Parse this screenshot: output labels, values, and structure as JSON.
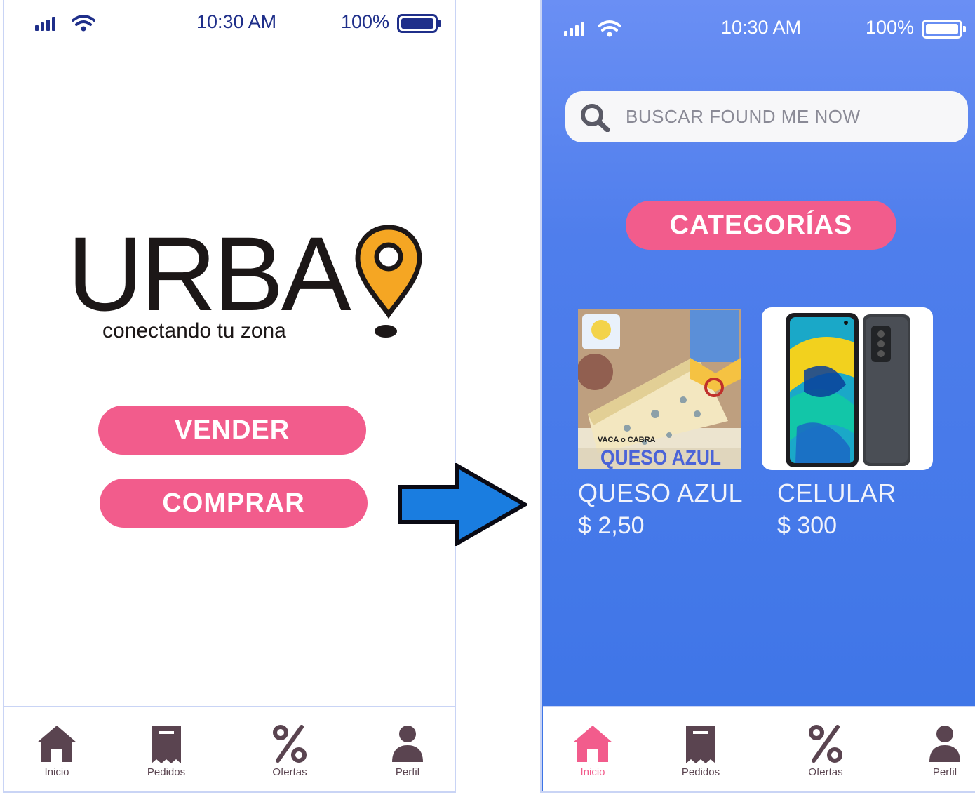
{
  "screens": {
    "landing": {
      "status_bar": {
        "time": "10:30 AM",
        "battery": "100%"
      },
      "logo": {
        "wordmark": "URBA",
        "tagline": "conectando tu zona"
      },
      "buttons": {
        "sell": "VENDER",
        "buy": "COMPRAR"
      },
      "tabs": [
        {
          "label": "Inicio",
          "icon": "home-icon"
        },
        {
          "label": "Pedidos",
          "icon": "receipt-icon"
        },
        {
          "label": "Ofertas",
          "icon": "percent-icon"
        },
        {
          "label": "Perfil",
          "icon": "user-icon"
        }
      ]
    },
    "catalog": {
      "status_bar": {
        "time": "10:30 AM",
        "battery": "100%"
      },
      "search": {
        "placeholder": "BUSCAR FOUND ME NOW"
      },
      "categories_label": "CATEGORÍAS",
      "products": [
        {
          "name": "QUESO AZUL",
          "price": "$ 2,50",
          "image_caption_small": "VACA o CABRA",
          "image_caption_large": "QUESO AZUL"
        },
        {
          "name": "CELULAR",
          "price": "$ 300"
        }
      ],
      "tabs": [
        {
          "label": "Inicio",
          "icon": "home-icon",
          "active": true
        },
        {
          "label": "Pedidos",
          "icon": "receipt-icon"
        },
        {
          "label": "Ofertas",
          "icon": "percent-icon"
        },
        {
          "label": "Perfil",
          "icon": "user-icon"
        }
      ]
    }
  },
  "colors": {
    "accent_pink": "#f25c8c",
    "logo_pin": "#f5a623",
    "background_blue": "#4f7eec",
    "arrow_blue": "#1a7de0",
    "icon_dark": "#5a4450",
    "status_dark": "#1f2f8a"
  }
}
